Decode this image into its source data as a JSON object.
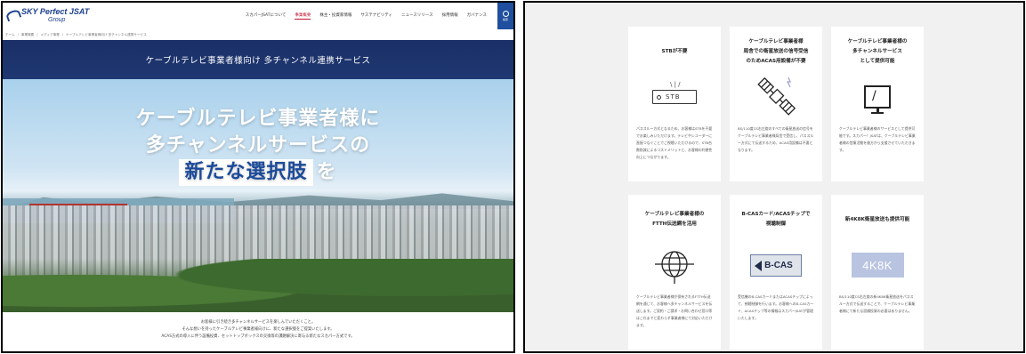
{
  "left": {
    "logo": {
      "line1": "SKY Perfect JSAT",
      "line2": "Group"
    },
    "nav": [
      "スカパーJSATについて",
      "事業概要",
      "株主・投資家情報",
      "サステナビリティ",
      "ニュースリリース",
      "採用情報",
      "ガバナンス"
    ],
    "nav_active_index": 1,
    "search_label": "検索",
    "breadcrumb": [
      "ホーム",
      "事業概要",
      "メディア事業",
      "ケーブルテレビ事業者様向け 多チャンネル連携サービス"
    ],
    "page_title": "ケーブルテレビ事業者様向け 多チャンネル連携サービス",
    "hero": {
      "line1": "ケーブルテレビ事業者様に",
      "line2": "多チャンネルサービスの",
      "highlight": "新たな選択肢",
      "suffix": "を"
    },
    "intro": [
      "お客様に引き続き多チャンネルサービスを楽しんでいただくこと。",
      "そんな想いを持ったケーブルテレビ事業者様向けに、新たな選択肢をご提案いたします。",
      "ACAS方式の導入に伴う設備投資、セットトップボックスの交換等の課題解決に寄与る新たなスカパー方式です。"
    ]
  },
  "right": {
    "cards": [
      {
        "title_lines": [
          "STBが不要"
        ],
        "image": "set-top-box-icon",
        "image_label": "STB",
        "desc": "パススルー方式となるため、お客様はSTBを不要でお楽しみいただけます。テレビやレコーダーに直接つなぐことでご視聴いただけるので、STB台数削減によるコストメリットと、お客様の利便性向上につながります。"
      },
      {
        "title_lines": [
          "ケーブルテレビ事業者様",
          "局舎での衛星放送の信号受信",
          "のためACAS用設備が不要"
        ],
        "image": "satellite-icon",
        "desc": "BS/110度CS右左旋のすべての衛星放送の信号をケーブルテレビ事業者様局舎で受信し、パススルー方式にて伝送するため、ACAS用設備は不要となります。"
      },
      {
        "title_lines": [
          "ケーブルテレビ事業者様の",
          "多チャンネルサービス",
          "として提供可能"
        ],
        "image": "monitor-icon",
        "desc": "ケーブルテレビ事業者様のサービスとして提供可能です。スカパー！JSATは、ケーブルテレビ事業者様の営業活動を後方から支援させていただきます。"
      },
      {
        "title_lines": [
          "ケーブルテレビ事業者様の",
          "FTTH伝送網を活用"
        ],
        "image": "globe-network-icon",
        "desc": "ケーブルテレビ事業者様が保有されるFTTH伝送網を通じて、お客様へ多チャンネルサービスを伝送します。ご契約・ご請求・お問い合わせ窓口等はこれまでと変わらず事業者様にて対応いただけます。"
      },
      {
        "title_lines": [
          "B-CASカード/ACASチップで",
          "視聴制御"
        ],
        "image": "b-cas-card-icon",
        "image_label": "B-CAS",
        "desc": "受信機のB-CASカードまたはACASチップによって、視聴制御を行います。お客様へのB-CASカード、ACASチップ等の情報はスカパーJSATが管理いたします。"
      },
      {
        "title_lines": [
          "新4K8K衛星放送も提供可能"
        ],
        "image": "4k8k-badge-icon",
        "image_label": "4K8K",
        "desc": "BS/110度CS右左旋の新4K8K衛星放送をパススルー方式で伝送することで、ケーブルテレビ事業者様にて新たな設備投資の必要はありません。"
      }
    ]
  }
}
